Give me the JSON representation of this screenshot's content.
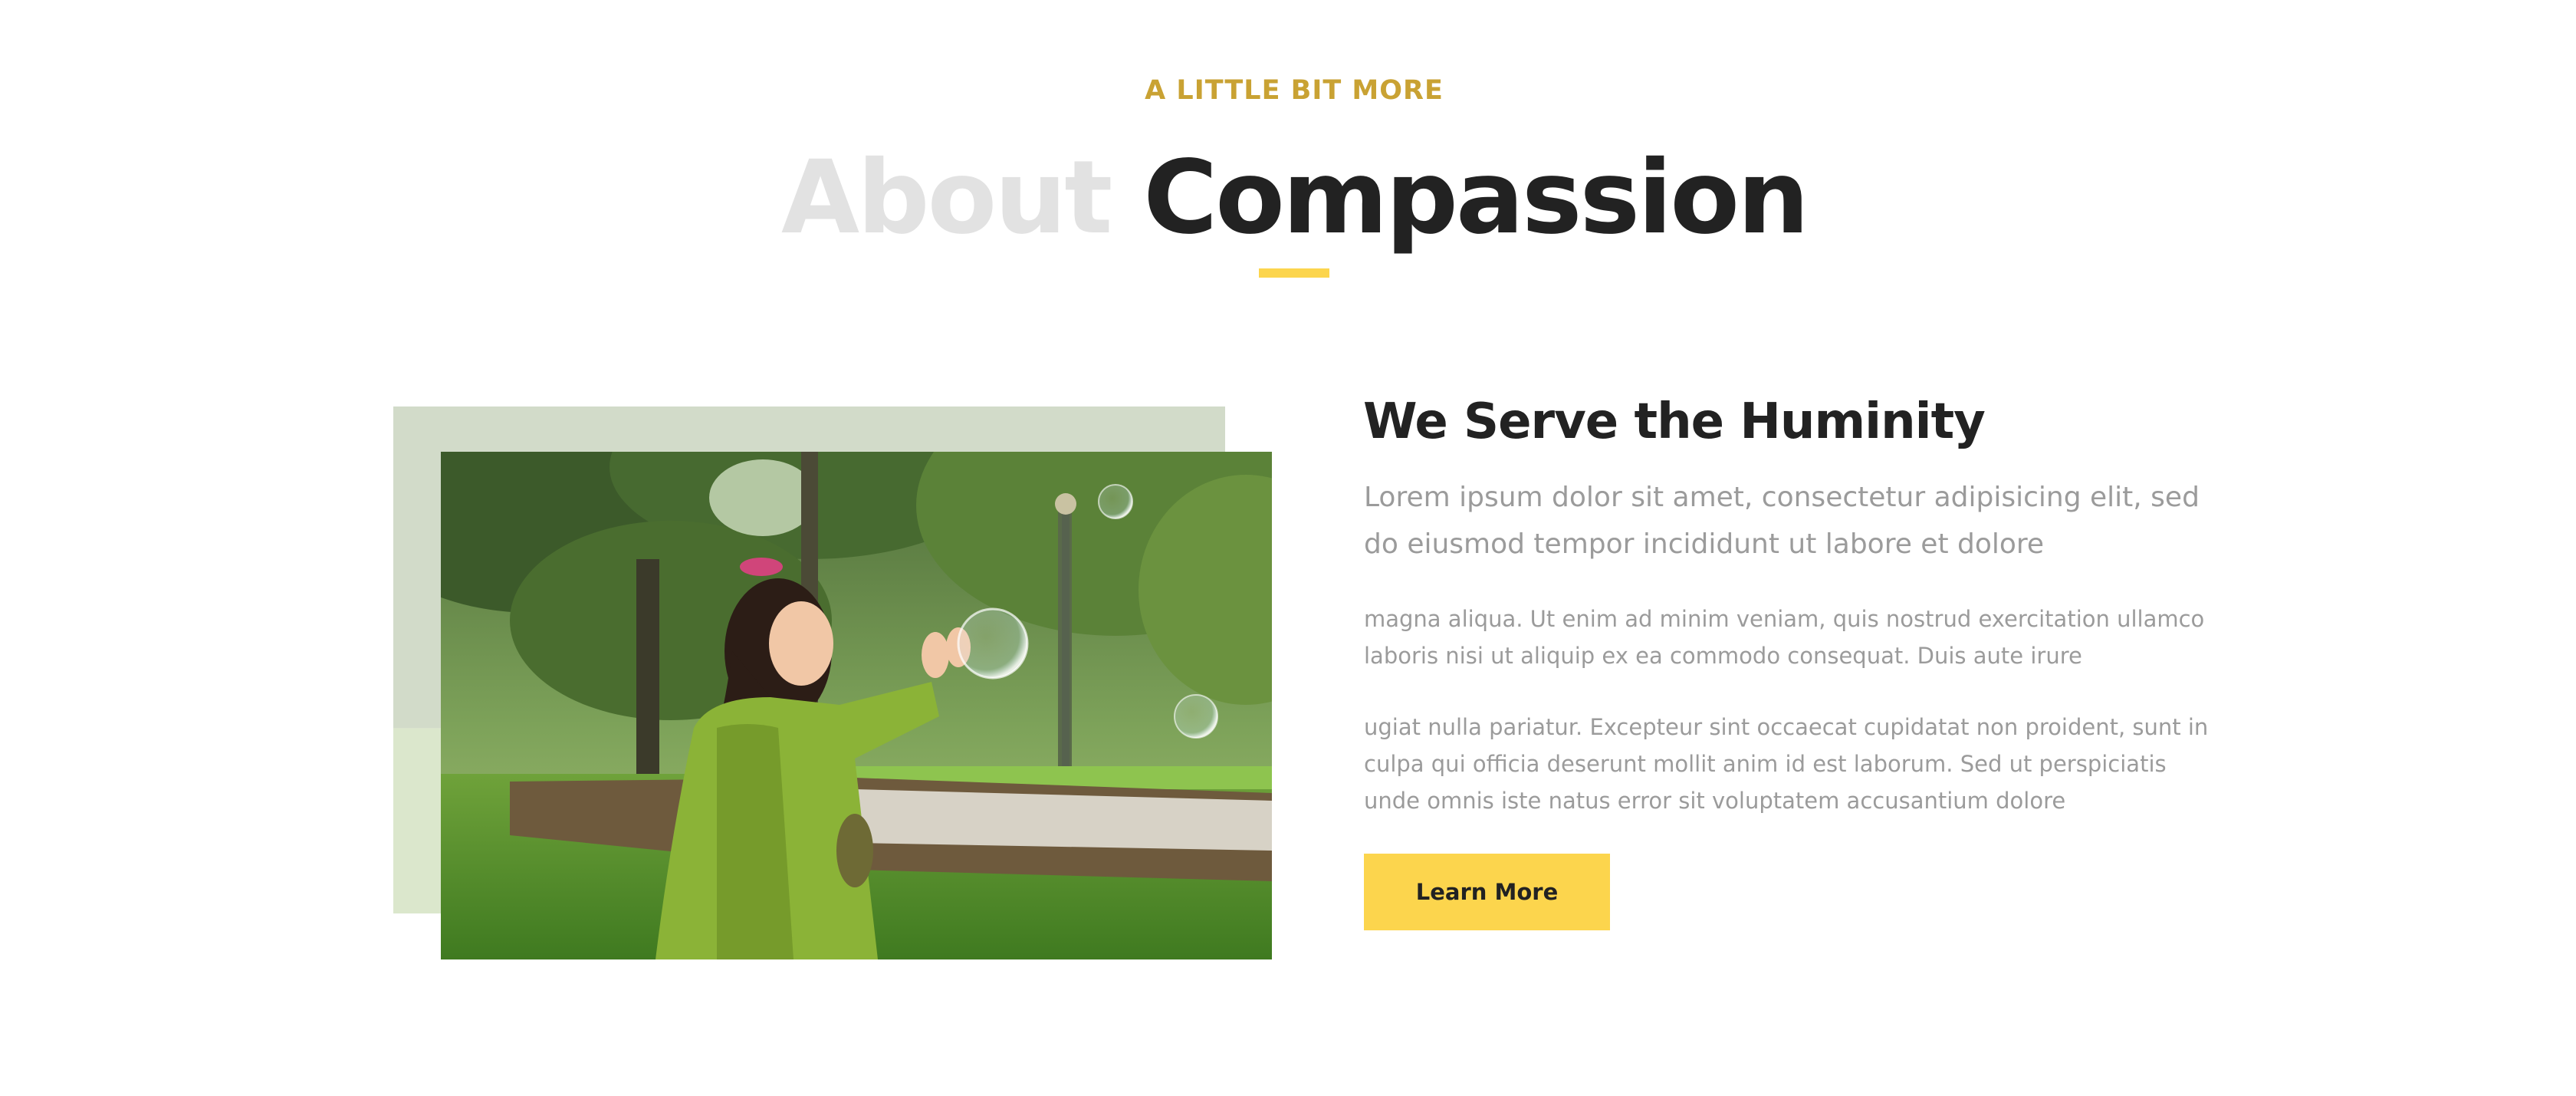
{
  "section": {
    "eyebrow": "A LITTLE BIT MORE",
    "title_faint": "About",
    "title_strong": "Compassion"
  },
  "about": {
    "heading": "We Serve the Huminity",
    "lead": "Lorem ipsum dolor sit amet, consectetur adipisicing elit, sed do eiusmod tempor incididunt ut labore et dolore",
    "paragraphs": [
      "magna aliqua. Ut enim ad minim veniam, quis nostrud exercitation ullamco laboris nisi ut aliquip ex ea commodo consequat. Duis aute irure",
      "ugiat nulla pariatur. Excepteur sint occaecat cupidatat non proident, sunt in culpa qui officia deserunt mollit anim id est laborum. Sed ut perspiciatis unde omnis iste natus error sit voluptatem accusantium dolore"
    ],
    "cta_label": "Learn More"
  },
  "colors": {
    "accent": "#fcd54d",
    "eyebrow": "#c9a233",
    "title_faint": "#e2e2e2",
    "title_strong": "#222222",
    "body_text": "#9b9b9b"
  },
  "image": {
    "subject": "girl-with-bubbles-photo"
  }
}
